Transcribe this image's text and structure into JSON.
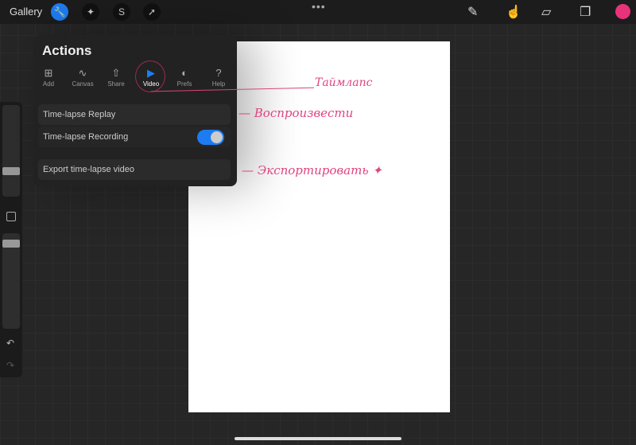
{
  "topbar": {
    "gallery": "Gallery",
    "tools": [
      "wrench-icon",
      "magic-wand-icon",
      "selection-icon",
      "transform-arrow-icon"
    ],
    "more": "•••",
    "right_tools": [
      "brush-icon",
      "smudge-icon",
      "eraser-icon",
      "layers-icon"
    ],
    "color": "#e8337a"
  },
  "actions": {
    "title": "Actions",
    "tabs": [
      {
        "label": "Add",
        "icon": "⊞"
      },
      {
        "label": "Canvas",
        "icon": "∿"
      },
      {
        "label": "Share",
        "icon": "⇧"
      },
      {
        "label": "Video",
        "icon": "▶"
      },
      {
        "label": "Prefs",
        "icon": "◐"
      },
      {
        "label": "Help",
        "icon": "?"
      }
    ],
    "rows": {
      "replay": "Time-lapse Replay",
      "recording": "Time-lapse Recording",
      "export": "Export time-lapse video"
    },
    "recording_on": true
  },
  "annotations": {
    "timelapse": "Таймлапс",
    "replay": "Воспроизвести",
    "export": "Экспортировать"
  }
}
